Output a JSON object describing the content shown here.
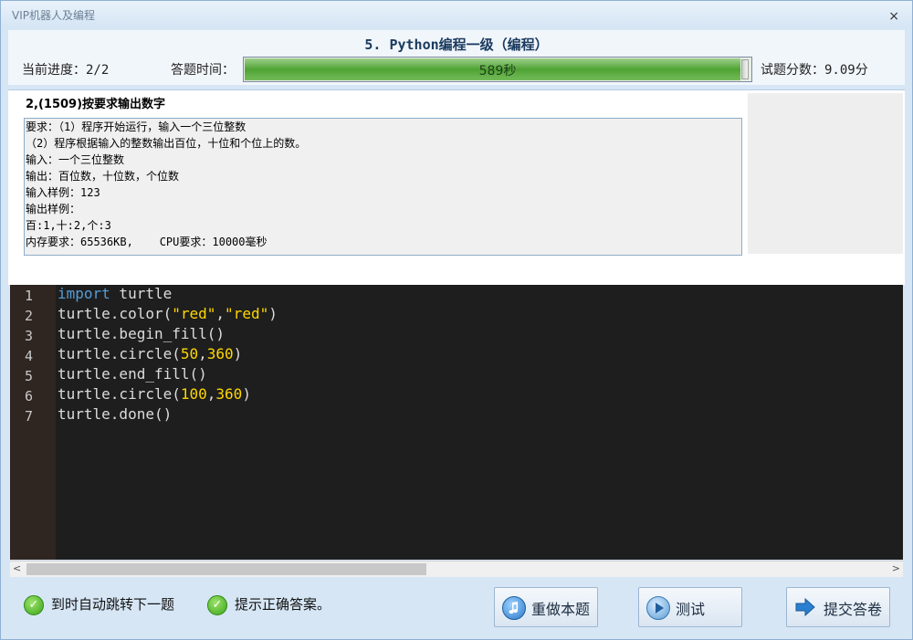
{
  "window": {
    "title": "VIP机器人及编程",
    "close_symbol": "×"
  },
  "header": {
    "question_title": "5. Python编程一级（编程）",
    "progress_label": "当前进度：2/2",
    "time_label": "答题时间：",
    "time_value": "589秒",
    "time_fraction": 0.98,
    "score_label": "试题分数：9.09分"
  },
  "question": {
    "heading": "2,(1509)按要求输出数字",
    "requirements": [
      "要求：（1）程序开始运行，输入一个三位整数",
      "（2）程序根据输入的整数输出百位，十位和个位上的数。",
      "输入：一个三位整数",
      "输出：百位数，十位数，个位数",
      "输入样例：123",
      "输出样例：",
      "百:1,十:2,个:3",
      "内存要求：65536KB,    CPU要求：10000毫秒"
    ]
  },
  "editor": {
    "line_numbers": [
      "1",
      "2",
      "3",
      "4",
      "5",
      "6",
      "7"
    ],
    "lines": [
      [
        {
          "t": "import",
          "c": "kw"
        },
        {
          "t": " turtle",
          "c": ""
        }
      ],
      [
        {
          "t": "turtle.color(",
          "c": ""
        },
        {
          "t": "\"red\"",
          "c": "str"
        },
        {
          "t": ",",
          "c": ""
        },
        {
          "t": "\"red\"",
          "c": "str"
        },
        {
          "t": ")",
          "c": ""
        }
      ],
      [
        {
          "t": "turtle.begin_fill()",
          "c": ""
        }
      ],
      [
        {
          "t": "turtle.circle(",
          "c": ""
        },
        {
          "t": "50",
          "c": "num"
        },
        {
          "t": ",",
          "c": ""
        },
        {
          "t": "360",
          "c": "num"
        },
        {
          "t": ")",
          "c": ""
        }
      ],
      [
        {
          "t": "turtle.end_fill()",
          "c": ""
        }
      ],
      [
        {
          "t": "turtle.circle(",
          "c": ""
        },
        {
          "t": "100",
          "c": "num"
        },
        {
          "t": ",",
          "c": ""
        },
        {
          "t": "360",
          "c": "num"
        },
        {
          "t": ")",
          "c": ""
        }
      ],
      [
        {
          "t": "turtle.done()",
          "c": ""
        }
      ]
    ]
  },
  "footer": {
    "auto_jump_label": "到时自动跳转下一题",
    "show_answer_label": "提示正确答案。",
    "redo_label": "重做本题",
    "test_label": "测试",
    "submit_label": "提交答卷",
    "check_symbol": "✓"
  },
  "colors": {
    "keyword": "#569cd6",
    "string": "#ffd700",
    "progress": "#4fa334"
  }
}
